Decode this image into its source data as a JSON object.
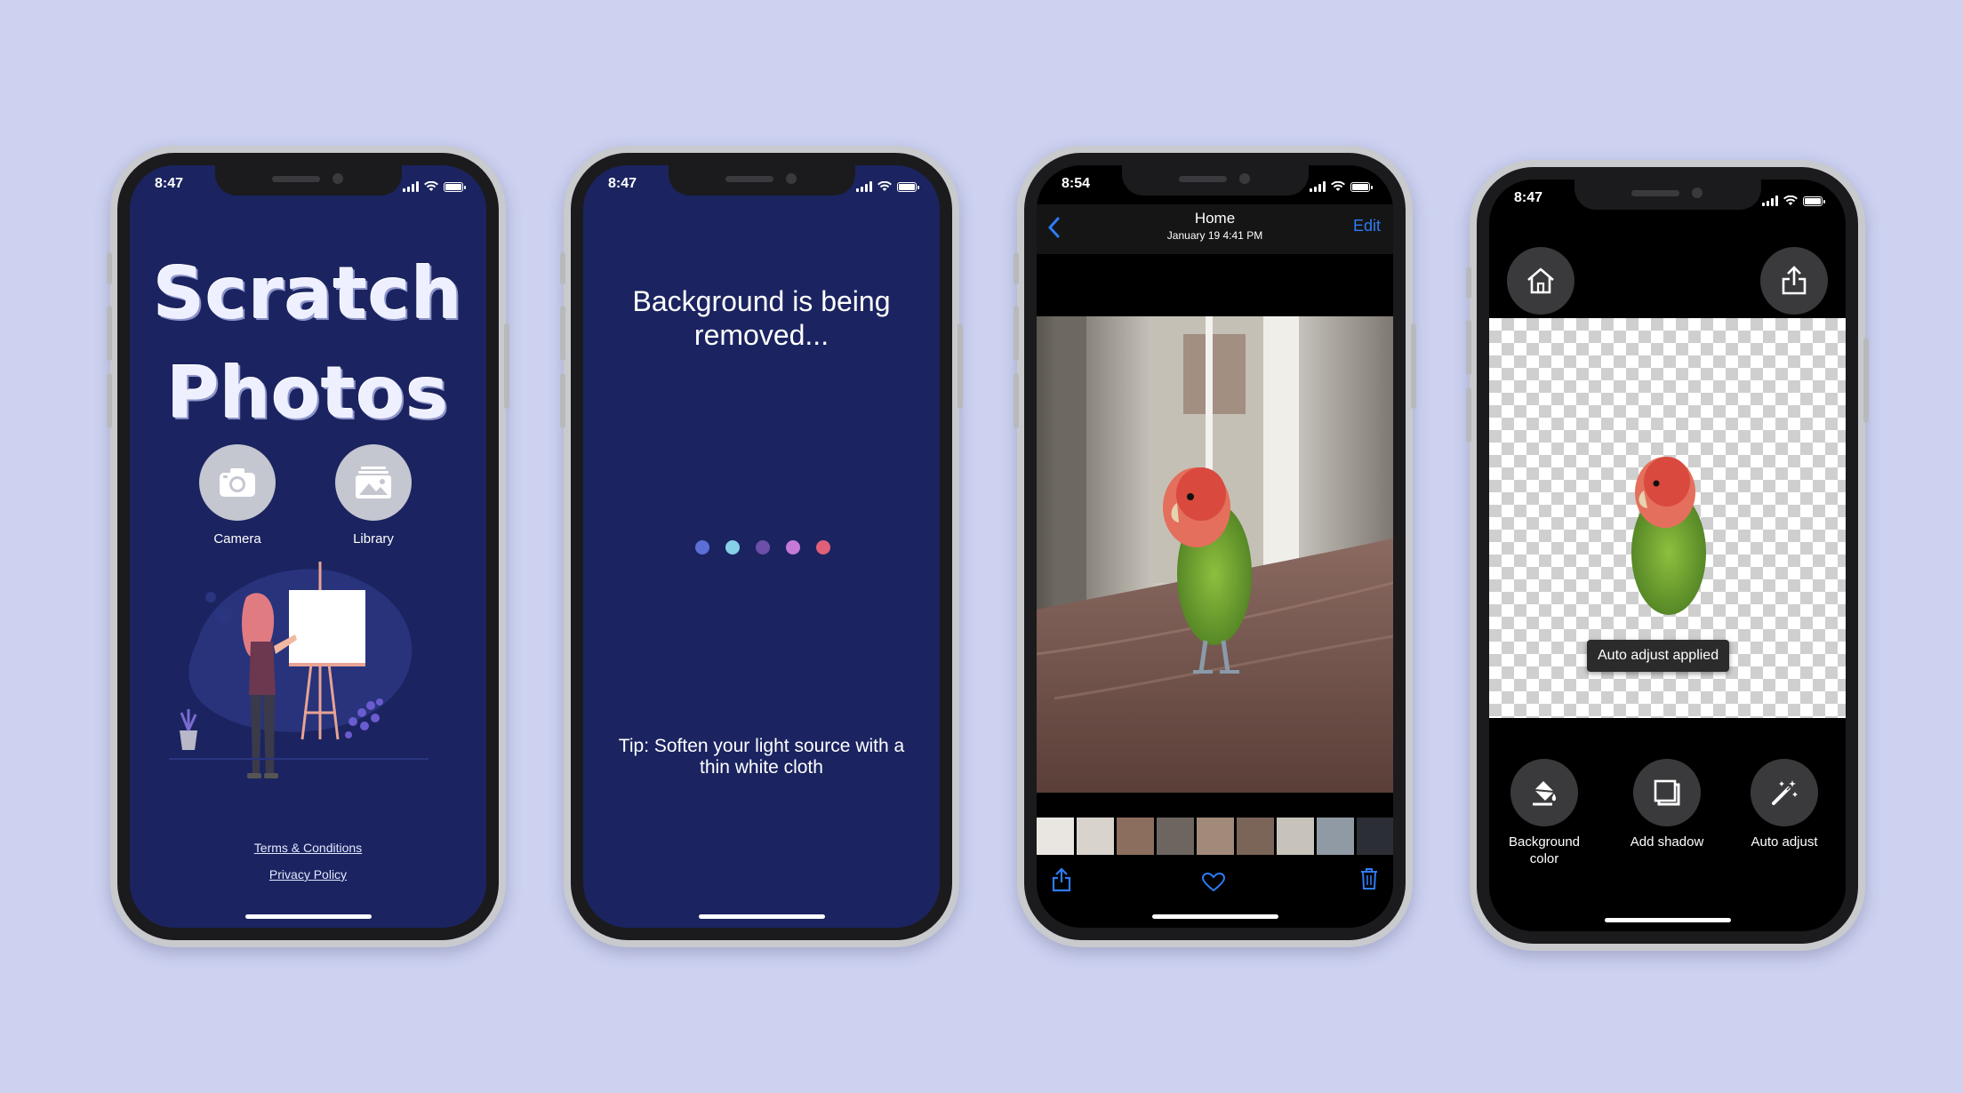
{
  "status": {
    "time_a": "8:47",
    "time_b": "8:54"
  },
  "screen1": {
    "title_line1": "Scratch",
    "title_line2": "Photos",
    "camera_label": "Camera",
    "library_label": "Library",
    "terms_link": "Terms & Conditions",
    "privacy_link": "Privacy Policy"
  },
  "screen2": {
    "loading_message": "Background is being removed...",
    "tip": "Tip: Soften your light source with a thin white cloth",
    "dot_colors": [
      "#5b6fd6",
      "#86d1e8",
      "#6b4fa8",
      "#c57ad8",
      "#e0607a"
    ]
  },
  "screen3": {
    "album_title": "Home",
    "date": "January 19  4:41 PM",
    "edit_label": "Edit"
  },
  "screen4": {
    "toast": "Auto adjust applied",
    "tools": [
      {
        "label": "Background color"
      },
      {
        "label": "Add shadow"
      },
      {
        "label": "Auto adjust"
      }
    ]
  },
  "colors": {
    "background": "#cdd2f1",
    "app_navy": "#1b2460",
    "ios_blue": "#2f7bf6"
  },
  "icons": [
    "camera-icon",
    "library-icon",
    "back-chevron-icon",
    "share-icon",
    "heart-icon",
    "trash-icon",
    "home-icon",
    "paint-bucket-icon",
    "shadow-icon",
    "magic-wand-icon"
  ]
}
